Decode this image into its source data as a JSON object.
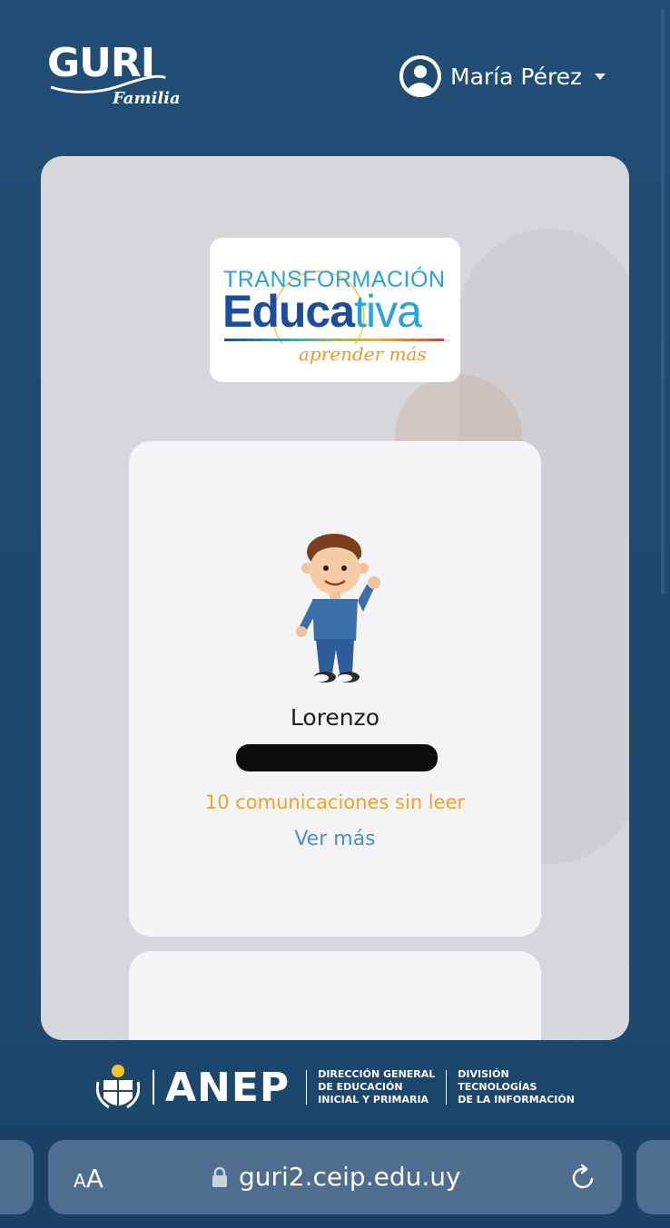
{
  "header": {
    "logo_text": "GURI",
    "logo_subtext": "Familia",
    "user_name": "María Pérez"
  },
  "banner": {
    "line1": "TRANSFORMACIÓN",
    "line2_a": "Educa",
    "line2_b": "tiva",
    "tagline": "aprender más"
  },
  "student": {
    "name": "Lorenzo",
    "unread_text": "10 comunicaciones sin leer",
    "link_label": "Ver más"
  },
  "footer": {
    "brand": "ANEP",
    "block1": [
      "DIRECCIÓN GENERAL",
      "DE EDUCACIÓN",
      "INICIAL Y PRIMARIA"
    ],
    "block2": [
      "DIVISIÓN",
      "TECNOLOGÍAS",
      "DE LA INFORMACIÓN"
    ]
  },
  "browser": {
    "aa_small": "A",
    "aa_big": "A",
    "url": "guri2.ceip.edu.uy"
  }
}
